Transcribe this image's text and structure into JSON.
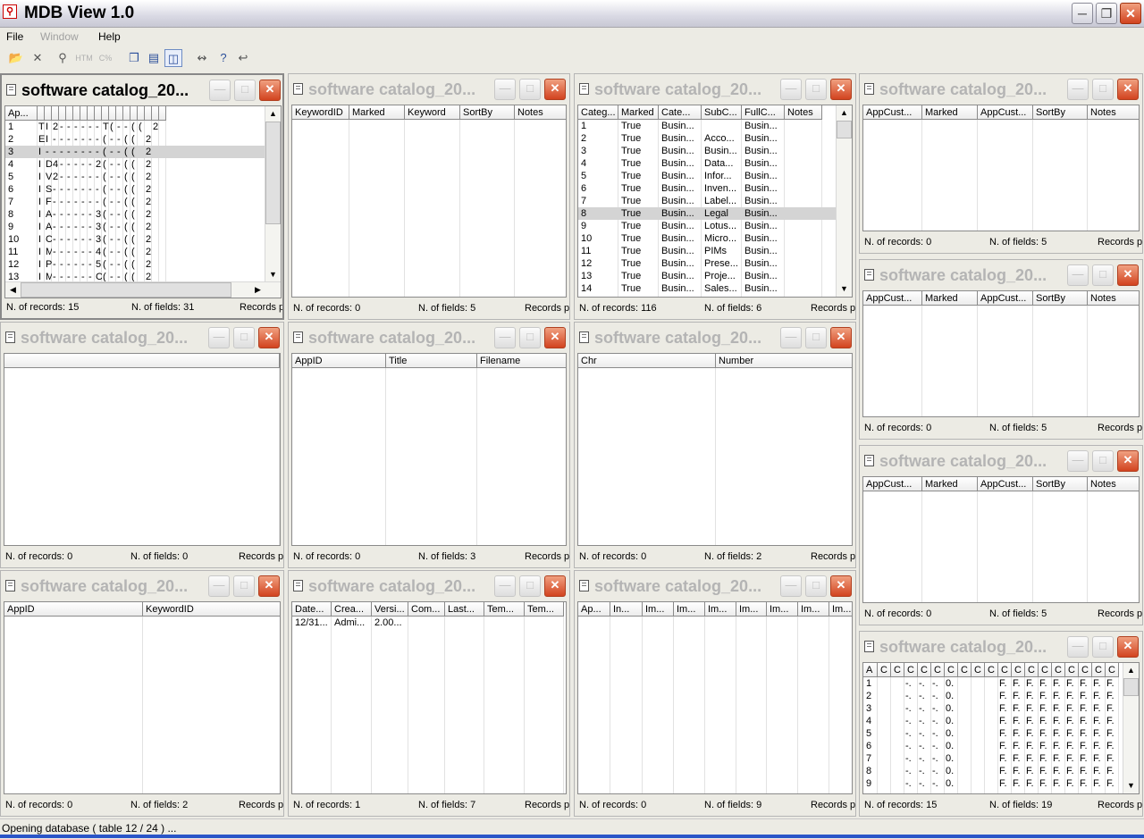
{
  "app": {
    "title": "MDB View 1.0",
    "icon": "key-icon"
  },
  "menu": [
    {
      "label": "File",
      "enabled": true
    },
    {
      "label": "Window",
      "enabled": false
    },
    {
      "label": "Help",
      "enabled": true
    }
  ],
  "toolbar_icons": [
    "open-folder-icon",
    "delete-icon",
    "search-icon",
    "html-export-icon",
    "csv-export-icon",
    "cascade-windows-icon",
    "tile-horizontal-icon",
    "tile-vertical-icon",
    "link-icon",
    "help-context-icon",
    "back-icon"
  ],
  "toolbar": {
    "html_label": "HTM",
    "csv_label": "C%"
  },
  "window_title": "software catalog_20...",
  "status_labels": {
    "records": "N. of records:",
    "fields": "N. of fields:",
    "records_per": "Records p"
  },
  "windows": [
    {
      "id": "w1",
      "records": "15",
      "fields": "31",
      "focused": true,
      "columns": [
        {
          "label": "Ap..."
        },
        {
          "label": ""
        },
        {
          "label": ""
        },
        {
          "label": ""
        },
        {
          "label": ""
        },
        {
          "label": ""
        },
        {
          "label": ""
        },
        {
          "label": ""
        },
        {
          "label": ""
        },
        {
          "label": ""
        },
        {
          "label": ""
        },
        {
          "label": ""
        },
        {
          "label": ""
        },
        {
          "label": ""
        },
        {
          "label": ""
        },
        {
          "label": ""
        },
        {
          "label": ""
        },
        {
          "label": ""
        },
        {
          "label": ""
        }
      ],
      "rows": [
        [
          "1",
          "T",
          "I",
          "2",
          "-",
          "-",
          "-",
          "-",
          "-",
          "-",
          "T",
          "(",
          "-",
          "-",
          "(",
          "(",
          "",
          "2",
          ""
        ],
        [
          "2",
          "E",
          "I",
          "-",
          "-",
          "-",
          "-",
          "-",
          "-",
          "-",
          "(",
          "-",
          "-",
          "(",
          "(",
          "",
          "2",
          "",
          ""
        ],
        [
          "3",
          "I",
          "-",
          "-",
          "-",
          "-",
          "-",
          "-",
          "-",
          "-",
          "(",
          "-",
          "-",
          "(",
          "(",
          "",
          "2",
          "",
          ""
        ],
        [
          "4",
          "I",
          "D",
          "4",
          "-",
          "-",
          "-",
          "-",
          "-",
          "2",
          "(",
          "-",
          "-",
          "(",
          "(",
          "",
          "2",
          "",
          ""
        ],
        [
          "5",
          "I",
          "V",
          "2",
          "-",
          "-",
          "-",
          "-",
          "-",
          "-",
          "(",
          "-",
          "-",
          "(",
          "(",
          "",
          "2",
          "",
          ""
        ],
        [
          "6",
          "I",
          "S",
          "-",
          "-",
          "-",
          "-",
          "-",
          "-",
          "-",
          "(",
          "-",
          "-",
          "(",
          "(",
          "",
          "2",
          "",
          ""
        ],
        [
          "7",
          "I",
          "F",
          "-",
          "-",
          "-",
          "-",
          "-",
          "-",
          "-",
          "(",
          "-",
          "-",
          "(",
          "(",
          "",
          "2",
          "",
          ""
        ],
        [
          "8",
          "I",
          "A",
          "-",
          "-",
          "-",
          "-",
          "-",
          "-",
          "3",
          "(",
          "-",
          "-",
          "(",
          "(",
          "",
          "2",
          "",
          ""
        ],
        [
          "9",
          "I",
          "A",
          "-",
          "-",
          "-",
          "-",
          "-",
          "-",
          "3",
          "(",
          "-",
          "-",
          "(",
          "(",
          "",
          "2",
          "",
          ""
        ],
        [
          "10",
          "I",
          "C",
          "-",
          "-",
          "-",
          "-",
          "-",
          "-",
          "3",
          "(",
          "-",
          "-",
          "(",
          "(",
          "",
          "2",
          "",
          ""
        ],
        [
          "11",
          "I",
          "M",
          "-",
          "-",
          "-",
          "-",
          "-",
          "-",
          "4",
          "(",
          "-",
          "-",
          "(",
          "(",
          "",
          "2",
          "",
          ""
        ],
        [
          "12",
          "I",
          "P",
          "-",
          "-",
          "-",
          "-",
          "-",
          "-",
          "5",
          "(",
          "-",
          "-",
          "(",
          "(",
          "",
          "2",
          "",
          ""
        ],
        [
          "13",
          "I",
          "M",
          "-",
          "-",
          "-",
          "-",
          "-",
          "-",
          "C",
          "(",
          "-",
          "-",
          "(",
          "(",
          "",
          "2",
          "",
          ""
        ]
      ],
      "selected_row": 2
    },
    {
      "id": "w2",
      "records": "0",
      "fields": "5",
      "columns": [
        {
          "label": "KeywordID"
        },
        {
          "label": "Marked"
        },
        {
          "label": "Keyword"
        },
        {
          "label": "SortBy"
        },
        {
          "label": "Notes"
        }
      ],
      "rows": []
    },
    {
      "id": "w3",
      "records": "116",
      "fields": "6",
      "columns": [
        {
          "label": "Categ..."
        },
        {
          "label": "Marked"
        },
        {
          "label": "Cate..."
        },
        {
          "label": "SubC..."
        },
        {
          "label": "FullC..."
        },
        {
          "label": "Notes"
        }
      ],
      "rows": [
        [
          "1",
          "True",
          "Busin...",
          "",
          "Busin...",
          ""
        ],
        [
          "2",
          "True",
          "Busin...",
          "Acco...",
          "Busin...",
          ""
        ],
        [
          "3",
          "True",
          "Busin...",
          "Busin...",
          "Busin...",
          ""
        ],
        [
          "4",
          "True",
          "Busin...",
          "Data...",
          "Busin...",
          ""
        ],
        [
          "5",
          "True",
          "Busin...",
          "Infor...",
          "Busin...",
          ""
        ],
        [
          "6",
          "True",
          "Busin...",
          "Inven...",
          "Busin...",
          ""
        ],
        [
          "7",
          "True",
          "Busin...",
          "Label...",
          "Busin...",
          ""
        ],
        [
          "8",
          "True",
          "Busin...",
          "Legal",
          "Busin...",
          ""
        ],
        [
          "9",
          "True",
          "Busin...",
          "Lotus...",
          "Busin...",
          ""
        ],
        [
          "10",
          "True",
          "Busin...",
          "Micro...",
          "Busin...",
          ""
        ],
        [
          "11",
          "True",
          "Busin...",
          "PIMs",
          "Busin...",
          ""
        ],
        [
          "12",
          "True",
          "Busin...",
          "Prese...",
          "Busin...",
          ""
        ],
        [
          "13",
          "True",
          "Busin...",
          "Proje...",
          "Busin...",
          ""
        ],
        [
          "14",
          "True",
          "Busin...",
          "Sales...",
          "Busin...",
          ""
        ]
      ],
      "selected_row": 7
    },
    {
      "id": "w4",
      "records": "0",
      "fields": "5",
      "columns": [
        {
          "label": "AppCust..."
        },
        {
          "label": "Marked"
        },
        {
          "label": "AppCust..."
        },
        {
          "label": "SortBy"
        },
        {
          "label": "Notes"
        }
      ],
      "rows": []
    },
    {
      "id": "w5",
      "records": "0",
      "fields": "0",
      "columns": [
        {
          "label": ""
        }
      ],
      "rows": []
    },
    {
      "id": "w6",
      "records": "0",
      "fields": "3",
      "columns": [
        {
          "label": "AppID"
        },
        {
          "label": "Title"
        },
        {
          "label": "Filename"
        }
      ],
      "rows": []
    },
    {
      "id": "w7",
      "records": "0",
      "fields": "2",
      "columns": [
        {
          "label": "Chr"
        },
        {
          "label": "Number"
        }
      ],
      "rows": []
    },
    {
      "id": "w8",
      "records": "0",
      "fields": "5",
      "columns": [
        {
          "label": "AppCust..."
        },
        {
          "label": "Marked"
        },
        {
          "label": "AppCust..."
        },
        {
          "label": "SortBy"
        },
        {
          "label": "Notes"
        }
      ],
      "rows": []
    },
    {
      "id": "w9",
      "records": "0",
      "fields": "5",
      "columns": [
        {
          "label": "AppCust..."
        },
        {
          "label": "Marked"
        },
        {
          "label": "AppCust..."
        },
        {
          "label": "SortBy"
        },
        {
          "label": "Notes"
        }
      ],
      "rows": []
    },
    {
      "id": "w10",
      "records": "0",
      "fields": "2",
      "columns": [
        {
          "label": "AppID"
        },
        {
          "label": "KeywordID"
        }
      ],
      "rows": []
    },
    {
      "id": "w11",
      "records": "1",
      "fields": "7",
      "columns": [
        {
          "label": "Date..."
        },
        {
          "label": "Crea..."
        },
        {
          "label": "Versi..."
        },
        {
          "label": "Com..."
        },
        {
          "label": "Last..."
        },
        {
          "label": "Tem..."
        },
        {
          "label": "Tem..."
        }
      ],
      "rows": [
        [
          "12/31...",
          "Admi...",
          "2.00...",
          "",
          "",
          "",
          ""
        ]
      ]
    },
    {
      "id": "w12",
      "records": "0",
      "fields": "9",
      "columns": [
        {
          "label": "Ap..."
        },
        {
          "label": "In..."
        },
        {
          "label": "Im..."
        },
        {
          "label": "Im..."
        },
        {
          "label": "Im..."
        },
        {
          "label": "Im..."
        },
        {
          "label": "Im..."
        },
        {
          "label": "Im..."
        },
        {
          "label": "Im..."
        }
      ],
      "rows": []
    },
    {
      "id": "w13",
      "records": "15",
      "fields": "19",
      "columns": [
        {
          "label": "A"
        },
        {
          "label": "C"
        },
        {
          "label": "C"
        },
        {
          "label": "C"
        },
        {
          "label": "C"
        },
        {
          "label": "C"
        },
        {
          "label": "C"
        },
        {
          "label": "C"
        },
        {
          "label": "C"
        },
        {
          "label": "C"
        },
        {
          "label": "C"
        },
        {
          "label": "C"
        },
        {
          "label": "C"
        },
        {
          "label": "C"
        },
        {
          "label": "C"
        },
        {
          "label": "C"
        },
        {
          "label": "C"
        },
        {
          "label": "C"
        },
        {
          "label": "C"
        }
      ],
      "rows": [
        [
          "1",
          "",
          "",
          "-.",
          "-.",
          "-.",
          "0.",
          "",
          "",
          "",
          "F.",
          "F.",
          "F.",
          "F.",
          "F.",
          "F.",
          "F.",
          "F.",
          "F."
        ],
        [
          "2",
          "",
          "",
          "-.",
          "-.",
          "-.",
          "0.",
          "",
          "",
          "",
          "F.",
          "F.",
          "F.",
          "F.",
          "F.",
          "F.",
          "F.",
          "F.",
          "F."
        ],
        [
          "3",
          "",
          "",
          "-.",
          "-.",
          "-.",
          "0.",
          "",
          "",
          "",
          "F.",
          "F.",
          "F.",
          "F.",
          "F.",
          "F.",
          "F.",
          "F.",
          "F."
        ],
        [
          "4",
          "",
          "",
          "-.",
          "-.",
          "-.",
          "0.",
          "",
          "",
          "",
          "F.",
          "F.",
          "F.",
          "F.",
          "F.",
          "F.",
          "F.",
          "F.",
          "F."
        ],
        [
          "5",
          "",
          "",
          "-.",
          "-.",
          "-.",
          "0.",
          "",
          "",
          "",
          "F.",
          "F.",
          "F.",
          "F.",
          "F.",
          "F.",
          "F.",
          "F.",
          "F."
        ],
        [
          "6",
          "",
          "",
          "-.",
          "-.",
          "-.",
          "0.",
          "",
          "",
          "",
          "F.",
          "F.",
          "F.",
          "F.",
          "F.",
          "F.",
          "F.",
          "F.",
          "F."
        ],
        [
          "7",
          "",
          "",
          "-.",
          "-.",
          "-.",
          "0.",
          "",
          "",
          "",
          "F.",
          "F.",
          "F.",
          "F.",
          "F.",
          "F.",
          "F.",
          "F.",
          "F."
        ],
        [
          "8",
          "",
          "",
          "-.",
          "-.",
          "-.",
          "0.",
          "",
          "",
          "",
          "F.",
          "F.",
          "F.",
          "F.",
          "F.",
          "F.",
          "F.",
          "F.",
          "F."
        ],
        [
          "9",
          "",
          "",
          "-.",
          "-.",
          "-.",
          "0.",
          "",
          "",
          "",
          "F.",
          "F.",
          "F.",
          "F.",
          "F.",
          "F.",
          "F.",
          "F.",
          "F."
        ]
      ]
    }
  ],
  "app_status": "Opening database ( table 12 / 24 ) ...",
  "colors": {
    "close_button": "#d2431f",
    "selected_row": "#d4d4d4",
    "grid_header": "#ececec"
  }
}
